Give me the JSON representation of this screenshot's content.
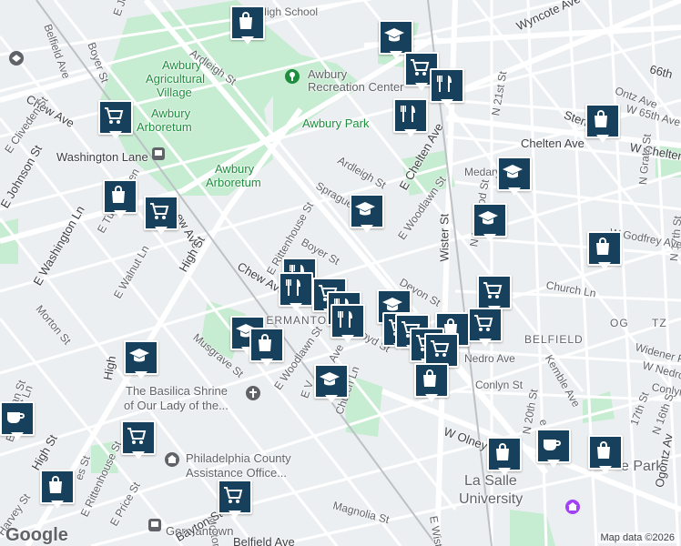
{
  "map": {
    "attribution": "Map data ©2026",
    "logo": "Google",
    "parks": [
      "Awbury Agricultural Village",
      "Awbury Arboretum",
      "Awbury Park"
    ],
    "labels": [
      {
        "id": "high-school",
        "text": "ing High School"
      },
      {
        "id": "ardleigh-st-1",
        "text": "Ardleigh St"
      },
      {
        "id": "awbury-rec",
        "text": "Awbury"
      },
      {
        "id": "awbury-rec-2",
        "text": "Recreation Center"
      },
      {
        "id": "awbury-agri-1",
        "text": "Awbury"
      },
      {
        "id": "awbury-agri-2",
        "text": "Agricultural"
      },
      {
        "id": "awbury-agri-3",
        "text": "Village"
      },
      {
        "id": "awbury-arb-1",
        "text": "Awbury"
      },
      {
        "id": "awbury-arb-2",
        "text": "Arboretum"
      },
      {
        "id": "awbury-park",
        "text": "Awbury Park"
      },
      {
        "id": "awbury-arb2-1",
        "text": "Awbury"
      },
      {
        "id": "awbury-arb2-2",
        "text": "Arboretum"
      },
      {
        "id": "washington-lane",
        "text": "Washington Lane"
      },
      {
        "id": "belfield-ave",
        "text": "Belfield Ave"
      },
      {
        "id": "boyer-st-1",
        "text": "Boyer St"
      },
      {
        "id": "e-johnson-st-1",
        "text": "E Johnson St"
      },
      {
        "id": "chew-ave-1",
        "text": "Chew Ave"
      },
      {
        "id": "e-cliveden-st",
        "text": "E Cliveden St"
      },
      {
        "id": "e-johnson-st-2",
        "text": "E Johnson St"
      },
      {
        "id": "e-washington-ln",
        "text": "E Washington Ln"
      },
      {
        "id": "e-tulpehocken",
        "text": "E Tulpehocken"
      },
      {
        "id": "ew-ave",
        "text": "ew Ave"
      },
      {
        "id": "e-walnut-ln",
        "text": "E Walnut Ln"
      },
      {
        "id": "high-st-1",
        "text": "High St"
      },
      {
        "id": "morton-st-1",
        "text": "Morton St"
      },
      {
        "id": "chew-ave-2",
        "text": "Chew Ave"
      },
      {
        "id": "e-rittenhouse-st",
        "text": "E Rittenhouse St"
      },
      {
        "id": "boyer-st-2",
        "text": "Boyer St"
      },
      {
        "id": "sprague-st",
        "text": "Sprague St"
      },
      {
        "id": "ardleigh-st-2",
        "text": "Ardleigh St"
      },
      {
        "id": "e-chelten-ave",
        "text": "E Chelten Ave"
      },
      {
        "id": "e-woodlawn-st-1",
        "text": "E Woodlawn St"
      },
      {
        "id": "wister-st",
        "text": "Wister St"
      },
      {
        "id": "devon-st",
        "text": "Devon St"
      },
      {
        "id": "germantown-hood",
        "text": "GERMANTO"
      },
      {
        "id": "lloyd-st",
        "text": "oyd St"
      },
      {
        "id": "musgrave-st",
        "text": "Musgrave St"
      },
      {
        "id": "e-woodlawn-st-2",
        "text": "E Woodlawn St"
      },
      {
        "id": "e-v-ave",
        "text": "E V"
      },
      {
        "id": "e-ave",
        "text": "Ave"
      },
      {
        "id": "church-ln-1",
        "text": "Church Ln"
      },
      {
        "id": "basilica-1",
        "text": "The Basilica Shrine"
      },
      {
        "id": "basilica-2",
        "text": "of Our Lady of the..."
      },
      {
        "id": "high-st-2",
        "text": "High"
      },
      {
        "id": "e-walnut-ln-2",
        "text": "E Walnut Ln"
      },
      {
        "id": "ian-st",
        "text": "ian St"
      },
      {
        "id": "high-st-3",
        "text": "High St"
      },
      {
        "id": "es-st",
        "text": "es St"
      },
      {
        "id": "phila-county-1",
        "text": "Philadelphia County"
      },
      {
        "id": "phila-county-2",
        "text": "Assistance Office..."
      },
      {
        "id": "e-rittenhouse-st-2",
        "text": "E Rittenhouse St"
      },
      {
        "id": "e-price-st",
        "text": "E Price St"
      },
      {
        "id": "morton-st-2",
        "text": "Morton St"
      },
      {
        "id": "harvey-st",
        "text": "Harvey St"
      },
      {
        "id": "germantown-station",
        "text": "Germantown"
      },
      {
        "id": "bayton-st",
        "text": "Bayton St"
      },
      {
        "id": "belfield-ave-2",
        "text": "Belfield Ave"
      },
      {
        "id": "magnolia-st",
        "text": "Magnolia St"
      },
      {
        "id": "w-olney-ave",
        "text": "W Olney Ave"
      },
      {
        "id": "e-wister-st",
        "text": "E Wister St"
      },
      {
        "id": "la-salle-1",
        "text": "La Salle"
      },
      {
        "id": "la-salle-2",
        "text": "University"
      },
      {
        "id": "wyncote-ave",
        "text": "Wyncote Ave"
      },
      {
        "id": "66th-ave",
        "text": "66th"
      },
      {
        "id": "w-65th-ave",
        "text": "W 65th Ave"
      },
      {
        "id": "n-21st-st",
        "text": "N 21st St"
      },
      {
        "id": "ontz-ave",
        "text": "Ontz Ave"
      },
      {
        "id": "stenton",
        "text": "Sten"
      },
      {
        "id": "chelten-ave",
        "text": "Chelten Ave"
      },
      {
        "id": "w-chelten",
        "text": "W Chelten"
      },
      {
        "id": "medary",
        "text": "Medary"
      },
      {
        "id": "n-grata",
        "text": "N Gratz St"
      },
      {
        "id": "n-17th-st",
        "text": "N 17th St"
      },
      {
        "id": "w-godfrey-ave",
        "text": "W Godfrey Ave"
      },
      {
        "id": "n-norwood-st",
        "text": "N Norwood St"
      },
      {
        "id": "church-ln-2",
        "text": "Church Ln"
      },
      {
        "id": "belfield-hood",
        "text": "BELFIELD"
      },
      {
        "id": "ogontz-hood",
        "text": "OG"
      },
      {
        "id": "ogontz-hood-2",
        "text": "TZ"
      },
      {
        "id": "widener-pl",
        "text": "Widener Pl"
      },
      {
        "id": "nedro-ave",
        "text": "Nedro Ave"
      },
      {
        "id": "w-nedro-ave",
        "text": "W Nedro Av"
      },
      {
        "id": "kemble-ave",
        "text": "Kemble Ave"
      },
      {
        "id": "conlyn-st",
        "text": "Conlyn St"
      },
      {
        "id": "conlyn-st-2",
        "text": "Conlyn St"
      },
      {
        "id": "n-20th-st",
        "text": "N 20th St"
      },
      {
        "id": "park",
        "text": "e Park"
      },
      {
        "id": "ogontz-ave",
        "text": "Ogontz Av"
      },
      {
        "id": "17th-st",
        "text": "17th St"
      },
      {
        "id": "n-16th-st",
        "text": "N 16th S"
      },
      {
        "id": "e-ave-2",
        "text": "e Av"
      }
    ],
    "markers": [
      {
        "id": "m1",
        "icon": "shopping-bag"
      },
      {
        "id": "m2",
        "icon": "shopping-bag"
      },
      {
        "id": "m3",
        "icon": "school"
      },
      {
        "id": "m4",
        "icon": "shopping-cart"
      },
      {
        "id": "m5",
        "icon": "restaurant"
      },
      {
        "id": "m6",
        "icon": "restaurant"
      },
      {
        "id": "m7",
        "icon": "shopping-cart"
      },
      {
        "id": "m8",
        "icon": "shopping-bag"
      },
      {
        "id": "m9",
        "icon": "shopping-cart"
      },
      {
        "id": "m10",
        "icon": "school"
      },
      {
        "id": "m11",
        "icon": "school"
      },
      {
        "id": "m12",
        "icon": "school"
      },
      {
        "id": "m13",
        "icon": "shopping-bag"
      },
      {
        "id": "m14",
        "icon": "restaurant"
      },
      {
        "id": "m15",
        "icon": "restaurant"
      },
      {
        "id": "m16",
        "icon": "shopping-cart"
      },
      {
        "id": "m17",
        "icon": "restaurant"
      },
      {
        "id": "m18",
        "icon": "restaurant"
      },
      {
        "id": "m19",
        "icon": "school"
      },
      {
        "id": "m20",
        "icon": "shopping-cart"
      },
      {
        "id": "m21",
        "icon": "shopping-cart"
      },
      {
        "id": "m22",
        "icon": "shopping-cart"
      },
      {
        "id": "m23",
        "icon": "shopping-bag"
      },
      {
        "id": "m24",
        "icon": "shopping-cart"
      },
      {
        "id": "m25",
        "icon": "shopping-cart"
      },
      {
        "id": "m26",
        "icon": "shopping-cart"
      },
      {
        "id": "m27",
        "icon": "school"
      },
      {
        "id": "m28",
        "icon": "shopping-bag"
      },
      {
        "id": "m29",
        "icon": "school"
      },
      {
        "id": "m30",
        "icon": "school"
      },
      {
        "id": "m31",
        "icon": "shopping-bag"
      },
      {
        "id": "m32",
        "icon": "coffee"
      },
      {
        "id": "m33",
        "icon": "shopping-cart"
      },
      {
        "id": "m34",
        "icon": "shopping-bag"
      },
      {
        "id": "m35",
        "icon": "coffee"
      },
      {
        "id": "m36",
        "icon": "shopping-bag"
      },
      {
        "id": "m37",
        "icon": "shopping-cart"
      },
      {
        "id": "m38",
        "icon": "shopping-bag"
      }
    ],
    "colors": {
      "marker": "#17405c",
      "park": "#c6ecd1",
      "road": "#ffffff",
      "block": "#e8eaed",
      "background": "#f1f3f4"
    }
  }
}
